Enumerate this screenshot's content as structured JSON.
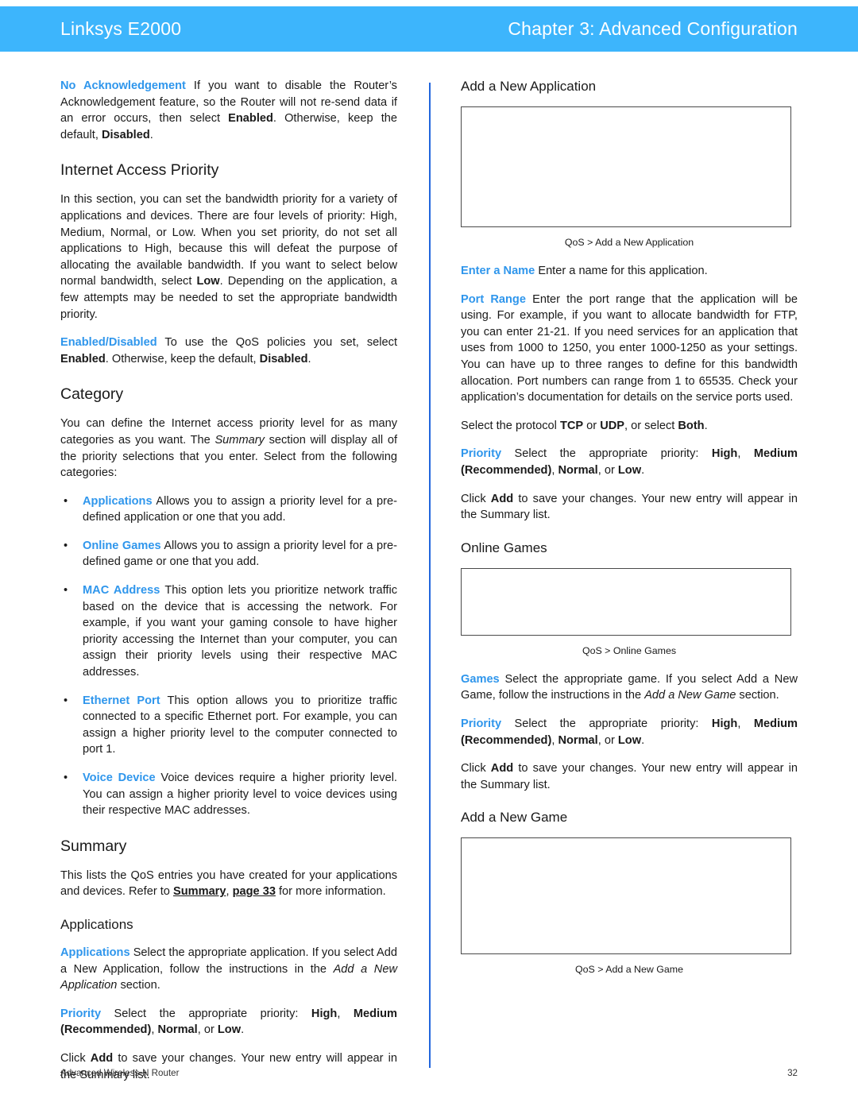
{
  "header": {
    "product": "Linksys E2000",
    "chapter": "Chapter 3: Advanced Configuration",
    "band_color": "#3db5fc"
  },
  "accent_color": "#2f96ec",
  "divider_color": "#2266dd",
  "left_column": {
    "no_ack": {
      "term": "No Acknowledgement",
      "text_1": " If you want to disable the Router’s Acknowledgement feature, so the Router will not re-send data if an error occurs, then select ",
      "bold_1": "Enabled",
      "text_2": ". Otherwise, keep the default, ",
      "bold_2": "Disabled",
      "text_3": "."
    },
    "heading_internet_access_priority": "Internet Access Priority",
    "iap_para": {
      "text_1": "In this section, you can set the bandwidth priority for a variety of applications and devices. There are four levels of priority: High, Medium, Normal, or Low. When you set priority, do not set all applications to High, because this will defeat the purpose of allocating the available bandwidth. If you want to select below normal bandwidth, select ",
      "bold_1": "Low",
      "text_2": ". Depending on the application, a few attempts may be needed to set the appropriate bandwidth priority."
    },
    "enabled_disabled": {
      "term": "Enabled/Disabled",
      "text_1": "  To use the QoS policies you set, select ",
      "bold_1": "Enabled",
      "text_2": ". Otherwise, keep the default, ",
      "bold_2": "Disabled",
      "text_3": "."
    },
    "heading_category": "Category",
    "category_para": {
      "text_1": "You can define the Internet access priority level for as many categories as you want. The ",
      "italic_1": "Summary",
      "text_2": " section will display all of the priority selections that you enter. Select from the following categories:"
    },
    "bullets": [
      {
        "term": "Applications",
        "text": "  Allows you to assign a priority level for a pre-defined application or one that you add."
      },
      {
        "term": "Online Games",
        "text": "  Allows you to assign a priority level for a pre-defined game or one that you add."
      },
      {
        "term": "MAC Address",
        "text": "  This option lets you prioritize network traffic based on the device that is accessing the network. For example, if you want your gaming console to have higher priority accessing the Internet than your computer, you can assign their priority levels using their respective MAC addresses."
      },
      {
        "term": "Ethernet Port",
        "text": " This option allows you to prioritize traffic connected to a specific Ethernet port. For example, you can assign a higher priority level to the computer connected to port 1."
      },
      {
        "term": "Voice Device",
        "text": "  Voice devices require a higher priority level. You can assign a higher priority level to voice devices using their respective MAC addresses."
      }
    ],
    "heading_summary": "Summary",
    "summary_para": {
      "text_1": "This lists the QoS entries you have created for your applications and devices. Refer to ",
      "link_1": "Summary",
      "text_2": ", ",
      "link_2": "page 33",
      "text_3": " for more information."
    },
    "heading_applications": "Applications",
    "applications_para": {
      "term": "Applications",
      "text_1": "  Select the appropriate application. If you select Add a New Application, follow the instructions in the ",
      "italic_1": "Add a New Application",
      "text_2": " section."
    },
    "priority_para": {
      "term": "Priority",
      "text_1": "  Select the appropriate priority: ",
      "bold_1": "High",
      "text_2": ", ",
      "bold_2": "Medium (Recommended)",
      "text_3": ", ",
      "bold_3": "Normal",
      "text_4": ", or ",
      "bold_4": "Low",
      "text_5": "."
    },
    "click_add_para": {
      "text_1": "Click ",
      "bold_1": "Add",
      "text_2": " to save your changes. Your new entry will appear in the Summary list."
    }
  },
  "right_column": {
    "heading_add_new_application": "Add a New Application",
    "figure_app_caption": "QoS > Add a New Application",
    "enter_a_name": {
      "term": "Enter a Name",
      "text_1": "  Enter a name for this application."
    },
    "port_range": {
      "term": "Port Range",
      "text_1": "  Enter the port range that the application will be using. For example, if you want to allocate bandwidth for FTP, you can enter 21-21. If you need services for an application that uses from 1000 to 1250, you enter 1000-1250 as your settings. You can have up to three ranges to define for this bandwidth allocation. Port numbers can range from 1 to 65535. Check your application’s documentation for details on the service ports used."
    },
    "protocol_para": {
      "text_1": "Select the protocol ",
      "bold_1": "TCP",
      "text_2": " or ",
      "bold_2": "UDP",
      "text_3": ", or select ",
      "bold_3": "Both",
      "text_4": "."
    },
    "priority_para": {
      "term": "Priority",
      "text_1": "  Select the appropriate priority: ",
      "bold_1": "High",
      "text_2": ", ",
      "bold_2": "Medium (Recommended)",
      "text_3": ", ",
      "bold_3": "Normal",
      "text_4": ", or ",
      "bold_4": "Low",
      "text_5": "."
    },
    "click_add_para": {
      "text_1": "Click ",
      "bold_1": "Add",
      "text_2": " to save your changes. Your new entry will appear in the Summary list."
    },
    "heading_online_games": "Online Games",
    "figure_games_caption": "QoS > Online Games",
    "games_para": {
      "term": "Games",
      "text_1": "  Select the appropriate game. If you select Add a New Game, follow the instructions in the ",
      "italic_1": "Add a New Game",
      "text_2": " section."
    },
    "priority_para_2": {
      "term": "Priority",
      "text_1": "  Select the appropriate priority: ",
      "bold_1": "High",
      "text_2": ", ",
      "bold_2": "Medium (Recommended)",
      "text_3": ", ",
      "bold_3": "Normal",
      "text_4": ", or ",
      "bold_4": "Low",
      "text_5": "."
    },
    "click_add_para_2": {
      "text_1": "Click ",
      "bold_1": "Add",
      "text_2": " to save your changes. Your new entry will appear in the Summary list."
    },
    "heading_add_new_game": "Add a New Game",
    "figure_newgame_caption": "QoS > Add a New Game"
  },
  "footer": {
    "left": "Advanced Wireless-N Router",
    "page_number": "32"
  }
}
